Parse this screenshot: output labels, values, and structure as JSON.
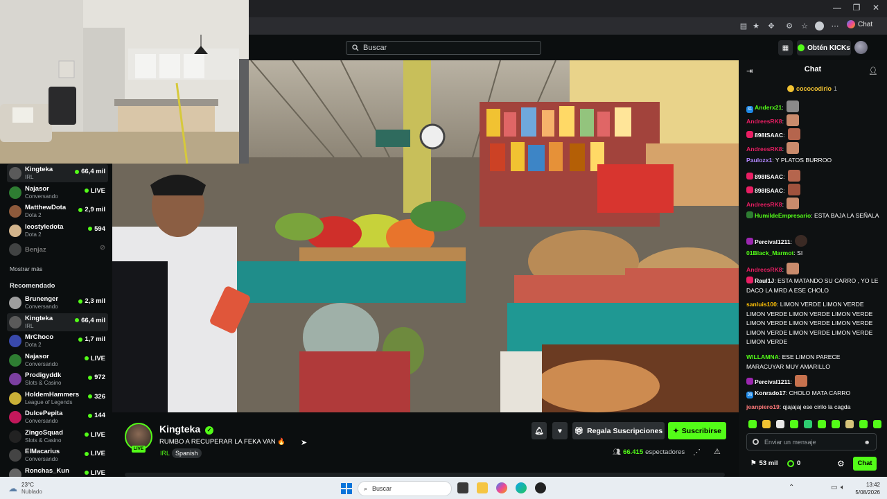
{
  "browser": {
    "chat_button_label": "Chat"
  },
  "header": {
    "search_placeholder": "Buscar",
    "get_kicks_label": "Obtén KICKs"
  },
  "sidebar": {
    "following": [
      {
        "name": "Kingteka",
        "sub": "IRL",
        "value": "66,4 mil",
        "active": true,
        "color": "#5a5a5a"
      },
      {
        "name": "Najasor",
        "sub": "Conversando",
        "value": "LIVE",
        "color": "#2e7d32"
      },
      {
        "name": "MatthewDota",
        "sub": "Dota 2",
        "value": "2,9 mil",
        "color": "#8d5a3b"
      },
      {
        "name": "leostyledota",
        "sub": "Dota 2",
        "value": "594",
        "color": "#d2b48c"
      },
      {
        "name": "Benjaz",
        "sub": "",
        "value": "",
        "offline": true,
        "color": "#777"
      }
    ],
    "show_more": "Mostrar más",
    "recommended_label": "Recomendado",
    "recommended": [
      {
        "name": "Brunenger",
        "sub": "Conversando",
        "value": "2,3 mil",
        "color": "#9e9e9e"
      },
      {
        "name": "Kingteka",
        "sub": "IRL",
        "value": "66,4 mil",
        "active": true,
        "color": "#5a5a5a"
      },
      {
        "name": "MrChoco",
        "sub": "Dota 2",
        "value": "1,7 mil",
        "color": "#3949ab"
      },
      {
        "name": "Najasor",
        "sub": "Conversando",
        "value": "LIVE",
        "color": "#2e7d32"
      },
      {
        "name": "Prodigyddk",
        "sub": "Slots & Casino",
        "value": "972",
        "color": "#7b3fa0"
      },
      {
        "name": "HoldemHammers",
        "sub": "League of Legends",
        "value": "326",
        "color": "#c9b037"
      },
      {
        "name": "DulcePepita",
        "sub": "Conversando",
        "value": "144",
        "color": "#c2185b"
      },
      {
        "name": "ZingoSquad",
        "sub": "Slots & Casino",
        "value": "LIVE",
        "color": "#222"
      },
      {
        "name": "ElMacarius",
        "sub": "Conversando",
        "value": "LIVE",
        "color": "#444"
      },
      {
        "name": "Ronchas_Kun",
        "sub": "",
        "value": "LIVE",
        "color": "#666"
      }
    ]
  },
  "stream": {
    "channel": "Kingteka",
    "title": "RUMBO A RECUPERAR LA FEKA VAN 🔥",
    "category": "IRL",
    "language": "Spanish",
    "live_badge": "LIVE",
    "viewers": "66.415",
    "viewers_label": "espectadores",
    "gift_label": "Regala Suscripciones",
    "subscribe_label": "Suscribirse"
  },
  "chat": {
    "title": "Chat",
    "pinned_user": "cococodirlo",
    "pinned_count": "1",
    "messages": [
      {
        "user": "Anderx21",
        "color": "#53fc18",
        "text": "",
        "emote": true,
        "badge": "31",
        "badge_color": "#1e88e5"
      },
      {
        "user": "AndreesRK8",
        "color": "#e91e63",
        "text": "",
        "emote": true
      },
      {
        "user": "898ISAAC",
        "color": "#ffffff",
        "text": "",
        "emote": true,
        "badge": "",
        "badge_color": "#e91e63"
      },
      {
        "user": "AndreesRK8",
        "color": "#e91e63",
        "text": "",
        "emote": true
      },
      {
        "user": "Paulozx1",
        "color": "#b388ff",
        "text": "Y PLATOS BURROO"
      },
      {
        "user": "898ISAAC",
        "color": "#ffffff",
        "text": "",
        "emote": true,
        "badge": "",
        "badge_color": "#e91e63"
      },
      {
        "user": "898ISAAC",
        "color": "#ffffff",
        "text": "",
        "emote": true,
        "badge": "",
        "badge_color": "#e91e63"
      },
      {
        "user": "AndreesRK8",
        "color": "#e91e63",
        "text": "",
        "emote": true
      },
      {
        "user": "HumildeEmpresario",
        "color": "#53fc18",
        "text": "ESTA BAJA LA SEÑALA",
        "badge": "",
        "badge_color": "#2e7d32"
      },
      {
        "user": "Percival1211",
        "color": "#ffffff",
        "text": "",
        "emote": true,
        "badge": "",
        "badge_color": "#9c27b0"
      },
      {
        "user": "01Black_Marmot",
        "color": "#53fc18",
        "text": "SI"
      },
      {
        "user": "AndreesRK8",
        "color": "#e91e63",
        "text": "",
        "emote": true
      },
      {
        "user": "Raul1J",
        "color": "#ffffff",
        "text": "ESTA MATANDO SU CARRO , YO LE DACO LA MRD A ESE CHOLO",
        "badge": "",
        "badge_color": "#e91e63"
      },
      {
        "user": "sanluis100",
        "color": "#ffc107",
        "text": "LIMON VERDE LIMON VERDE LIMON VERDE LIMON VERDE LIMON VERDE LIMON VERDE LIMON VERDE LIMON VERDE LIMON VERDE LIMON VERDE LIMON VERDE LIMON VERDE"
      },
      {
        "user": "WILLAMNA",
        "color": "#53fc18",
        "text": "ESE LIMON PARECE MARACUYAR MUY AMARILLO"
      },
      {
        "user": "Percival1211",
        "color": "#ffffff",
        "text": "",
        "emote": true,
        "badge": "",
        "badge_color": "#9c27b0"
      },
      {
        "user": "Konrado17",
        "color": "#ffffff",
        "text": "CHOLO MATA CARRO",
        "badge": "36",
        "badge_color": "#1e88e5"
      },
      {
        "user": "jeanpiero19",
        "color": "#ff7a7a",
        "text": "qjajajaj ese cirilo la cagda"
      }
    ],
    "input_placeholder": "Enviar un mensaje",
    "kicks_count": "53 mil",
    "points": "0",
    "send_label": "Chat"
  },
  "taskbar": {
    "weather_temp": "23°C",
    "weather_desc": "Nublado",
    "search_label": "Buscar",
    "time": "13:42",
    "date": "5/08/2026"
  },
  "colors": {
    "brand_green": "#53fc18",
    "bg": "#0b0e0f"
  }
}
